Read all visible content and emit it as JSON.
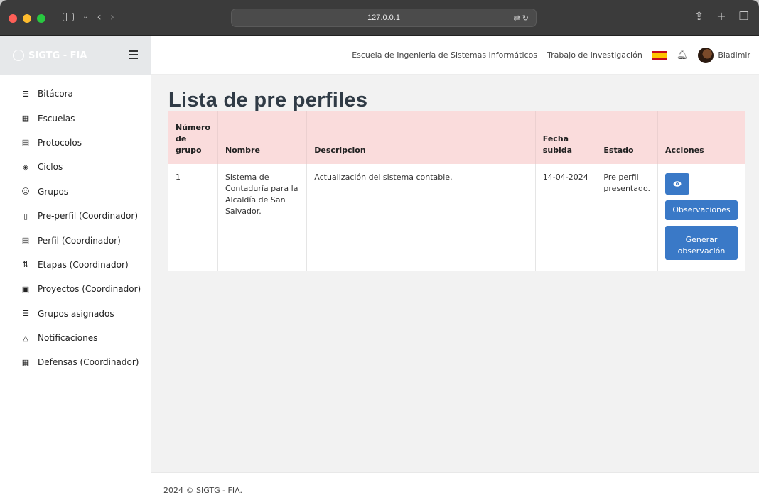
{
  "browser": {
    "url": "127.0.0.1"
  },
  "brand": {
    "name": "SIGTG - FIA"
  },
  "sidebar": {
    "items": [
      {
        "label": "Bitácora",
        "icon": "user-list-icon",
        "glyph": "☰"
      },
      {
        "label": "Escuelas",
        "icon": "building-icon",
        "glyph": "▦"
      },
      {
        "label": "Protocolos",
        "icon": "archive-icon",
        "glyph": "▤"
      },
      {
        "label": "Ciclos",
        "icon": "compass-icon",
        "glyph": "◈"
      },
      {
        "label": "Grupos",
        "icon": "users-icon",
        "glyph": "☺"
      },
      {
        "label": "Pre-perfil (Coordinador)",
        "icon": "file-icon",
        "glyph": "▯"
      },
      {
        "label": "Perfil (Coordinador)",
        "icon": "file-text-icon",
        "glyph": "▤"
      },
      {
        "label": "Etapas (Coordinador)",
        "icon": "git-pull-request-icon",
        "glyph": "⇅"
      },
      {
        "label": "Proyectos (Coordinador)",
        "icon": "code-square-icon",
        "glyph": "▣"
      },
      {
        "label": "Grupos asignados",
        "icon": "user-list-icon",
        "glyph": "☰"
      },
      {
        "label": "Notificaciones",
        "icon": "bell-icon",
        "glyph": "△"
      },
      {
        "label": "Defensas (Coordinador)",
        "icon": "calendar-icon",
        "glyph": "▦"
      }
    ]
  },
  "topbar": {
    "school": "Escuela de Ingeniería de Sistemas Informáticos",
    "module": "Trabajo de Investigación",
    "user": "Bladimir"
  },
  "page": {
    "title": "Lista de pre perfiles"
  },
  "table": {
    "headers": [
      "Número de grupo",
      "Nombre",
      "Descripcion",
      "Fecha subida",
      "Estado",
      "Acciones"
    ],
    "rows": [
      {
        "grupo": "1",
        "nombre": "Sistema de Contaduría para la Alcaldía de San Salvador.",
        "descripcion": "Actualización del sistema contable.",
        "fecha": "14-04-2024",
        "estado": "Pre perfil presentado."
      }
    ],
    "actions": {
      "observaciones": "Observaciones",
      "generar": "Generar observación"
    }
  },
  "footer": {
    "text": "2024 © SIGTG - FIA."
  }
}
